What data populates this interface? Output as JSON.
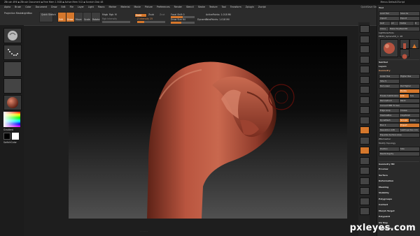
{
  "titlebar": {
    "title": "ZBrush 4R6 ▪ ZBrush Document ▪ Free Mem 1.5GB ▪ Active Mem 512 ▪ Scratch Disk 48",
    "right": "Menus  DefaultZScript"
  },
  "menubar": {
    "items": [
      "Alpha",
      "Brush",
      "Color",
      "Document",
      "Draw",
      "Edit",
      "File",
      "Layer",
      "Light",
      "Macro",
      "Marker",
      "Material",
      "Movie",
      "Picture",
      "Preferences",
      "Render",
      "Stencil",
      "Stroke",
      "Texture",
      "Tool",
      "Transform",
      "Zplugin",
      "Zscript"
    ],
    "quicksave": "QuickSave  See-through 0",
    "preset": "DefaultZScript"
  },
  "toolbar": {
    "projection_master": "Projection Master",
    "lightbox": "LightBox",
    "quick_sketch": "Quick Sketch",
    "edit": "Edit",
    "draw": "Draw",
    "move": "Move",
    "scale": "Scale",
    "rotate": "Rotate",
    "mrgb": "Mrgb",
    "rgb": "Rgb",
    "m": "M",
    "rgb_intensity": "Rgb Intensity",
    "zadd": "Zadd",
    "zsub": "Zsub",
    "zcut": "Zcut",
    "z_intensity": "Z Intensity 25",
    "focal_shift": "Focal Shift 0",
    "draw_size": "Draw Size 64",
    "dynamic": "Dynamic",
    "active_points": "ActivePoints: 1.018 Mil",
    "total_points": "TotalPoints: 1.018 Mil",
    "rgb_intensity_level": 0.0,
    "z_intensity_level": 0.25,
    "focal_shift_level": 0.5,
    "draw_size_level": 0.45
  },
  "left_shelf": {
    "color_label": "Gradient",
    "switch_label": "SwitchColor",
    "main_color": "#ffffff",
    "secondary_color": "#000000"
  },
  "right_shelf": {
    "buttons": [
      "BPR",
      "SPix 3",
      "Scroll",
      "Zoom",
      "Actual",
      "AAHalf",
      "Persp",
      "Floor",
      "Local",
      "L.Sym",
      "Frame",
      "Move",
      "Scale",
      "Rotate",
      "PolyF",
      "Transp",
      "Ghost",
      "Solo",
      "Xpose"
    ]
  },
  "tray": {
    "header": "Tool",
    "load_tool": "Load Tool",
    "save_as": "Save As",
    "import": "Import",
    "export": "Export",
    "goz": "GoZ",
    "all": "All",
    "visible": "Visible",
    "r": "R",
    "clone": "Clone",
    "make_polymesh": "Make PolyMesh3D",
    "lightbox_tools": "Lightbox▸Tools",
    "tool_count": "PM3D_Sphere3D_1. 48",
    "tool_names": [
      "PM3D_Sphere3D_1",
      "Cylinder3D",
      "SimpleBrush",
      "PM3D_Sphere3D_1"
    ],
    "subtool": "SubTool",
    "layers": "Layers",
    "geometry": "Geometry",
    "lower_res": "Lower Res",
    "higher_res": "Higher Res",
    "sdiv": "SDiv 5",
    "del_lower": "Del Lower",
    "del_higher": "Del Higher",
    "freeze_subdiv": "Freeze SubDivision Levels",
    "reconstruct_subdiv": "Reconstruct Subdiv",
    "convert_bpr": "Convert BPR To Geo",
    "divide": "Divide",
    "smt": "Smt",
    "suv": "Suv",
    "reuv": "ReUV",
    "edge_loop": "Edge Loop",
    "crease": "Crease",
    "shadowbox": "ShadowBox",
    "claypolish": "ClayPolish",
    "dynamesh": "DynaMesh",
    "groups": "Groups",
    "polish": "Polish",
    "blur": "Blur 2",
    "project": "Project",
    "resolution": "Resolution 128",
    "subprojection": "SubProjection 0.6",
    "equalize_surface": "Equalize Surface Area",
    "zremesher": "ZRemesher",
    "modify_topology": "Modify Topology",
    "position": "Position",
    "size": "Size",
    "meshintegrity": "MeshIntegrity",
    "geometry_hd": "Geometry HD",
    "sections": [
      "Preview",
      "Surface",
      "Deformation",
      "Masking",
      "Visibility",
      "Polygroups",
      "Contact",
      "Morph Target",
      "Polypaint",
      "UV Map",
      "Texture Map"
    ]
  },
  "colors": {
    "accent": "#d5772c",
    "clay": "#b5523f",
    "background": "#1e1e1e"
  },
  "watermark": "pxleyes.com",
  "footer": "· · · · · ·"
}
